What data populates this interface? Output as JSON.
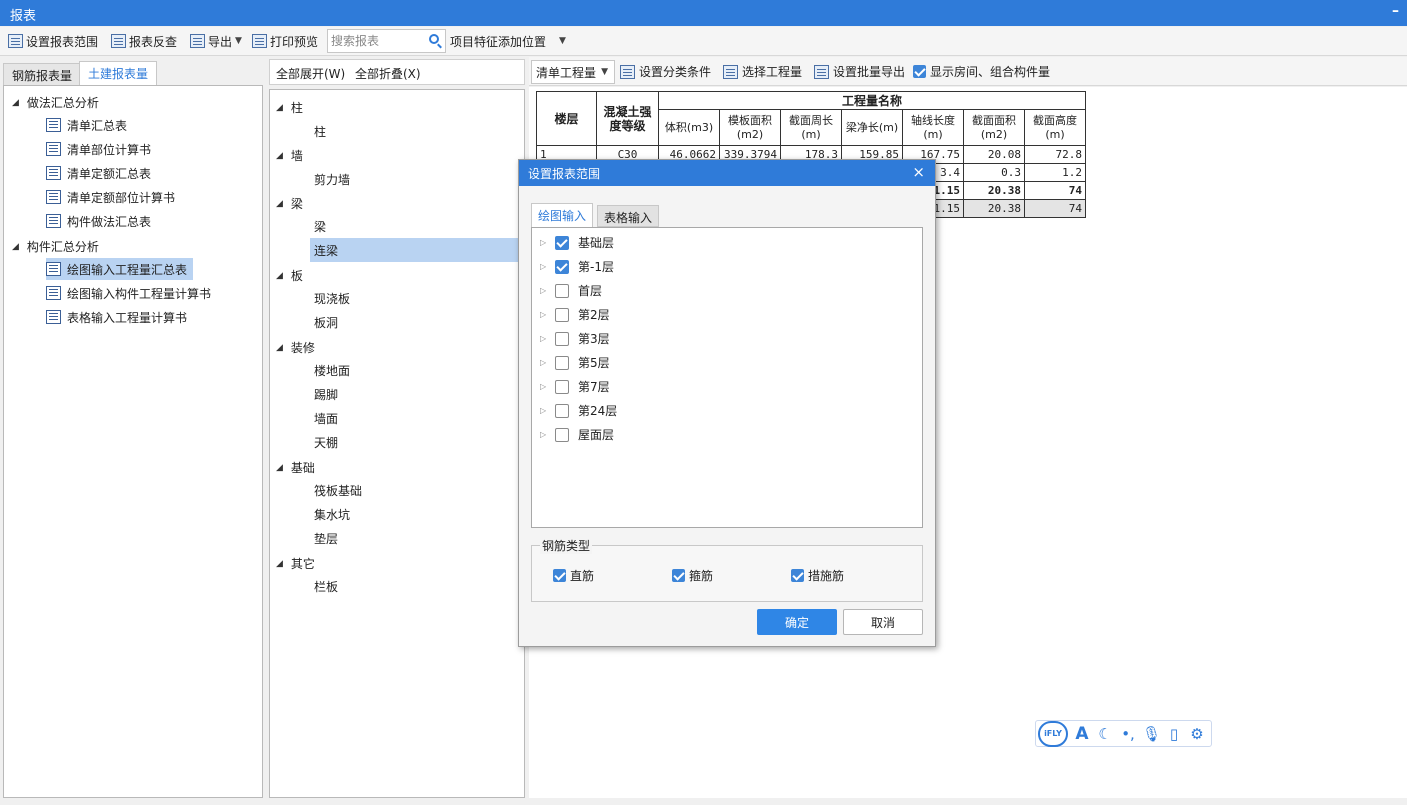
{
  "window": {
    "title": "报表",
    "minimize": "–"
  },
  "toolbar": {
    "set_range": "设置报表范围",
    "report_check": "报表反查",
    "export": "导出",
    "print_preview": "打印预览",
    "search_placeholder": "搜索报表",
    "feature_position": "项目特征添加位置"
  },
  "left_tabs": {
    "rebar": "钢筋报表量",
    "civil": "土建报表量"
  },
  "left_tree": {
    "group1": "做法汇总分析",
    "group1_items": [
      "清单汇总表",
      "清单部位计算书",
      "清单定额汇总表",
      "清单定额部位计算书",
      "构件做法汇总表"
    ],
    "group2": "构件汇总分析",
    "group2_items": [
      "绘图输入工程量汇总表",
      "绘图输入构件工程量计算书",
      "表格输入工程量计算书"
    ]
  },
  "middle": {
    "expand_all": "全部展开(W)",
    "collapse_all": "全部折叠(X)",
    "groups": [
      {
        "label": "柱",
        "items": [
          "柱"
        ]
      },
      {
        "label": "墙",
        "items": [
          "剪力墙"
        ]
      },
      {
        "label": "梁",
        "items": [
          "梁",
          "连梁"
        ]
      },
      {
        "label": "板",
        "items": [
          "现浇板",
          "板洞"
        ]
      },
      {
        "label": "装修",
        "items": [
          "楼地面",
          "踢脚",
          "墙面",
          "天棚"
        ]
      },
      {
        "label": "基础",
        "items": [
          "筏板基础",
          "集水坑",
          "垫层"
        ]
      },
      {
        "label": "其它",
        "items": [
          "栏板"
        ]
      }
    ]
  },
  "right_bar": {
    "mode": "清单工程量",
    "set_category": "设置分类条件",
    "select_quantity": "选择工程量",
    "batch_export": "设置批量导出",
    "show_rooms": "显示房间、组合构件量",
    "show_rooms_checked": true
  },
  "report": {
    "h_floor": "楼层",
    "h_grade": "混凝土强度等级",
    "h_group": "工程量名称",
    "cols": [
      "体积(m3)",
      "模板面积(m2)",
      "截面周长(m)",
      "梁净长(m)",
      "轴线长度(m)",
      "截面面积(m2)",
      "截面高度(m)"
    ],
    "row1": {
      "floor": "1",
      "grade": "C30",
      "values": [
        "46.0662",
        "339.3794",
        "178.3",
        "159.85",
        "167.75",
        "20.08",
        "72.8"
      ]
    },
    "row2": {
      "values": [
        "3.4",
        "0.3",
        "1.2"
      ]
    },
    "row3": {
      "values": [
        "1.15",
        "20.38",
        "74"
      ]
    },
    "row4": {
      "values": [
        "71.15",
        "20.38",
        "74"
      ]
    }
  },
  "dialog": {
    "title": "设置报表范围",
    "close": "×",
    "tab_draw": "绘图输入",
    "tab_table": "表格输入",
    "floors": [
      {
        "label": "基础层",
        "checked": true
      },
      {
        "label": "第-1层",
        "checked": true
      },
      {
        "label": "首层",
        "checked": false
      },
      {
        "label": "第2层",
        "checked": false
      },
      {
        "label": "第3层",
        "checked": false
      },
      {
        "label": "第5层",
        "checked": false
      },
      {
        "label": "第7层",
        "checked": false
      },
      {
        "label": "第24层",
        "checked": false
      },
      {
        "label": "屋面层",
        "checked": false
      }
    ],
    "rebar_type_label": "钢筋类型",
    "rebar_types": [
      {
        "label": "直筋",
        "checked": true
      },
      {
        "label": "箍筋",
        "checked": true
      },
      {
        "label": "措施筋",
        "checked": true
      }
    ],
    "ok": "确定",
    "cancel": "取消"
  },
  "ifly": {
    "logo": "iFLY",
    "icons": [
      "A",
      "moon-icon",
      "punctuation-icon",
      "mic-icon",
      "clipboard-icon",
      "gear-icon"
    ]
  }
}
